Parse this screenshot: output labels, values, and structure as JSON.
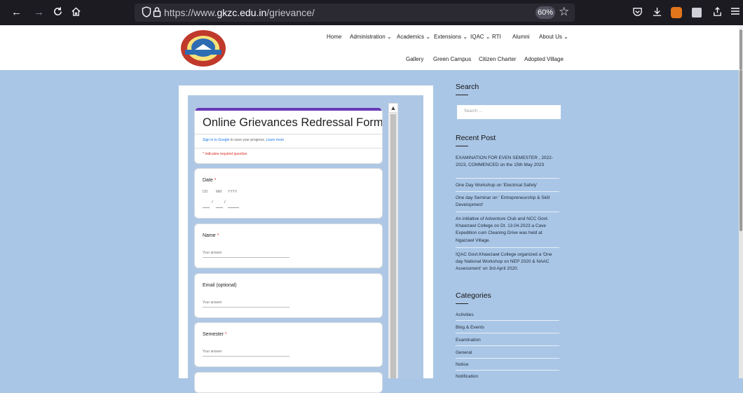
{
  "browser": {
    "back_icon": "←",
    "forward_icon": "→",
    "reload_icon": "C",
    "home_icon": "⌂",
    "url_prefix": "https://www.",
    "url_domain": "gkzc.edu.in",
    "url_path": "/grievance/",
    "zoom": "60%"
  },
  "nav": {
    "row1": [
      "Home",
      "Administration ⌄",
      "Academics ⌄",
      "Extensions ⌄",
      "IQAC ⌄",
      "RTI",
      "Alumni",
      "About Us ⌄"
    ],
    "row2": [
      "Gallery",
      "Green Campus",
      "Citizen Charter",
      "Adopted Village"
    ]
  },
  "logo": {
    "top_text": "KHAWZAWL COLLEGE",
    "motto": "Perseverance for Success",
    "bottom_text": "MIZORAM"
  },
  "form": {
    "title": "Online Grievances Redressal Form",
    "sign_in_link": "Sign in to Google",
    "sign_in_rest": " to save your progress.",
    "learn_more": "Learn more",
    "required_note": "* Indicates required question",
    "date_label": "Date",
    "date_dd": "DD",
    "date_mm": "MM",
    "date_yyyy": "YYYY",
    "date_sep": "/",
    "name_label": "Name",
    "email_label": "Email (optional)",
    "semester_label": "Semester",
    "answer_placeholder": "Your answer",
    "required_mark": "*"
  },
  "sidebar": {
    "search_heading": "Search",
    "search_placeholder": "Search ...",
    "recent_heading": "Recent Post",
    "posts": [
      "EXAMINATION FOR EVEN SEMESTER , 2022-2023, COMMENCED on the 15th May 2023",
      "One Day Workshop on 'Electrical Safety'",
      "One day Seminar on ' Entrepreneurship & Skill Development'",
      "An initiative of Adventure Club and NCC Govt. Khawzawl College on Dt. 13.04.2023 a Cave Expedition cum Cleaning Drive was held at Ngaizawl Village.",
      "IQAC Govt.Khawzawl College organized a 'One day National Workshop on NEP 2020 & NAAC Assessment' on 3rd April 2020."
    ],
    "categories_heading": "Categories",
    "categories": [
      "Activities",
      "Blog & Events",
      "Examination",
      "General",
      "Notice",
      "Notification"
    ]
  }
}
